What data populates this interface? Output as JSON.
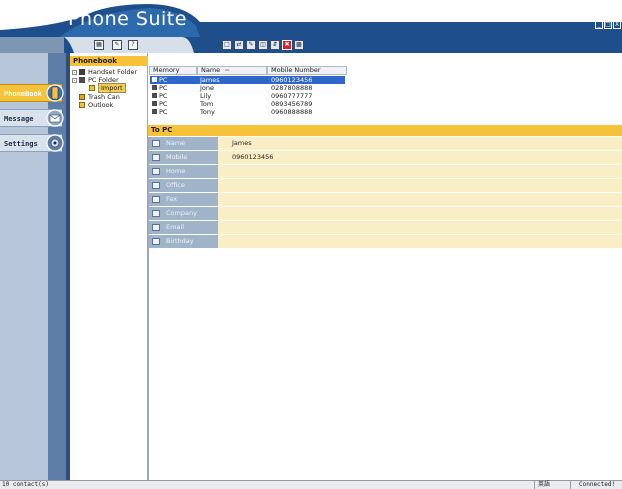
{
  "app": {
    "title": "Phone Suite"
  },
  "window_controls": [
    "_",
    "□",
    "X"
  ],
  "colors": {
    "accent": "#f5c23a",
    "navy": "#1e4f8c",
    "selection": "#2d67c9",
    "form_label": "#9fb3c9",
    "form_value": "#faeec6"
  },
  "nav": {
    "tabs": [
      {
        "label": "PhoneBook",
        "active": true,
        "icon": "phone-icon"
      },
      {
        "label": "Message",
        "active": false,
        "icon": "envelope-icon"
      },
      {
        "label": "Settings",
        "active": false,
        "icon": "gear-icon"
      }
    ]
  },
  "tree": {
    "header": "Phonebook",
    "items": [
      {
        "label": "Handset Folder",
        "icon": "handset-icon"
      },
      {
        "label": "PC Folder",
        "icon": "pc-icon"
      },
      {
        "label": "Import",
        "icon": "folder-icon",
        "selected": true
      },
      {
        "label": "Trash Can",
        "icon": "trash-icon"
      },
      {
        "label": "Outlook",
        "icon": "folder-icon"
      }
    ]
  },
  "list": {
    "columns": [
      "Memory",
      "Name",
      "Mobile Number"
    ],
    "rows": [
      {
        "memory": "PC",
        "name": "James",
        "mobile": "0960123456",
        "selected": true
      },
      {
        "memory": "PC",
        "name": "Jone",
        "mobile": "0287808888"
      },
      {
        "memory": "PC",
        "name": "Lily",
        "mobile": "0960777777"
      },
      {
        "memory": "PC",
        "name": "Tom",
        "mobile": "0893456789"
      },
      {
        "memory": "PC",
        "name": "Tony",
        "mobile": "0960888888"
      }
    ]
  },
  "detail": {
    "header": "To PC",
    "fields": [
      {
        "label": "Name",
        "value": "James",
        "icon": "person-icon"
      },
      {
        "label": "Mobile",
        "value": "0960123456",
        "icon": "mobile-icon"
      },
      {
        "label": "Home",
        "value": "",
        "icon": "home-icon"
      },
      {
        "label": "Office",
        "value": "",
        "icon": "office-icon"
      },
      {
        "label": "Fax",
        "value": "",
        "icon": "fax-icon"
      },
      {
        "label": "Company",
        "value": "",
        "icon": "company-icon"
      },
      {
        "label": "Email",
        "value": "",
        "icon": "email-icon"
      },
      {
        "label": "Birthday",
        "value": "",
        "icon": "calendar-icon"
      }
    ]
  },
  "status": {
    "count": "10 contact(s)",
    "mode": "英語",
    "connection": "Connected!"
  }
}
